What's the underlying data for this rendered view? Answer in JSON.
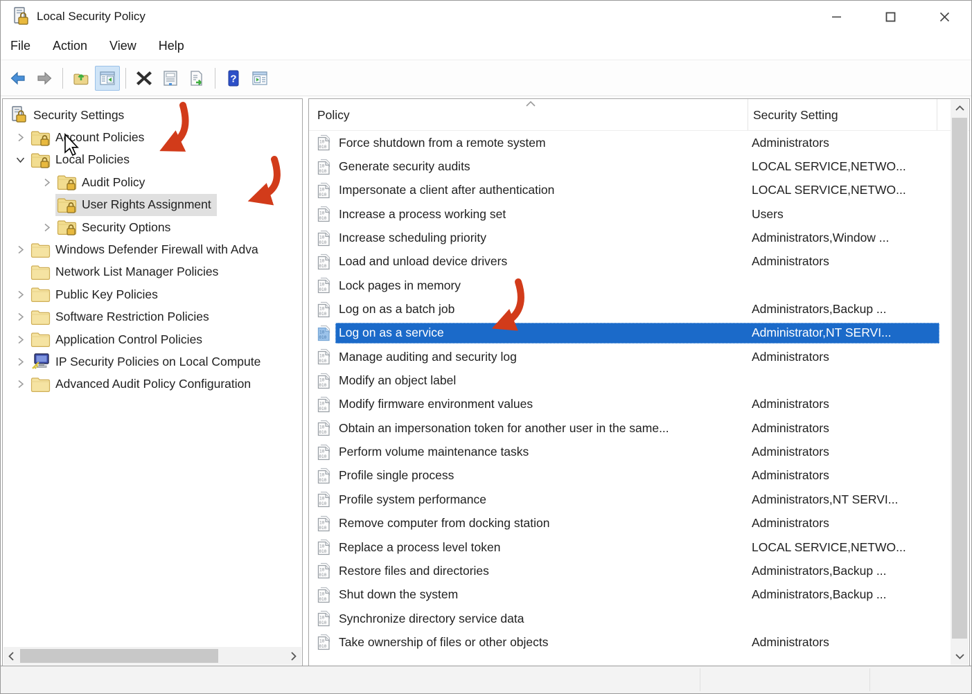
{
  "window": {
    "title": "Local Security Policy",
    "controls": {
      "minimize": "–",
      "maximize": "",
      "close": ""
    }
  },
  "menu": {
    "items": [
      {
        "label": "File"
      },
      {
        "label": "Action"
      },
      {
        "label": "View"
      },
      {
        "label": "Help"
      }
    ]
  },
  "toolbar": {
    "icons": [
      "back",
      "forward",
      "up-one-level",
      "show-hide-console-tree",
      "delete",
      "properties",
      "export-list",
      "help",
      "new-window"
    ],
    "active_icon": "show-hide-console-tree"
  },
  "tree": {
    "items": [
      {
        "label": "Security Settings",
        "level": 0,
        "expander": "none",
        "icon": "server-lock",
        "selected": false
      },
      {
        "label": "Account Policies",
        "level": 1,
        "expander": "collapsed",
        "icon": "folder-lock",
        "selected": false
      },
      {
        "label": "Local Policies",
        "level": 1,
        "expander": "expanded",
        "icon": "folder-lock",
        "selected": false
      },
      {
        "label": "Audit Policy",
        "level": 2,
        "expander": "collapsed",
        "icon": "folder-lock",
        "selected": false
      },
      {
        "label": "User Rights Assignment",
        "level": 2,
        "expander": "none",
        "icon": "folder-lock",
        "selected": true
      },
      {
        "label": "Security Options",
        "level": 2,
        "expander": "collapsed",
        "icon": "folder-lock",
        "selected": false
      },
      {
        "label": "Windows Defender Firewall with Adva",
        "level": 1,
        "expander": "collapsed",
        "icon": "folder",
        "selected": false
      },
      {
        "label": "Network List Manager Policies",
        "level": 1,
        "expander": "none",
        "icon": "folder",
        "selected": false
      },
      {
        "label": "Public Key Policies",
        "level": 1,
        "expander": "collapsed",
        "icon": "folder",
        "selected": false
      },
      {
        "label": "Software Restriction Policies",
        "level": 1,
        "expander": "collapsed",
        "icon": "folder",
        "selected": false
      },
      {
        "label": "Application Control Policies",
        "level": 1,
        "expander": "collapsed",
        "icon": "folder",
        "selected": false
      },
      {
        "label": "IP Security Policies on Local Compute",
        "level": 1,
        "expander": "collapsed",
        "icon": "ipsec",
        "selected": false
      },
      {
        "label": "Advanced Audit Policy Configuration",
        "level": 1,
        "expander": "collapsed",
        "icon": "folder",
        "selected": false
      }
    ]
  },
  "list": {
    "columns": [
      {
        "label": "Policy"
      },
      {
        "label": "Security Setting"
      }
    ],
    "sort": "ascending",
    "rows": [
      {
        "policy": "Force shutdown from a remote system",
        "setting": "Administrators",
        "selected": false
      },
      {
        "policy": "Generate security audits",
        "setting": "LOCAL SERVICE,NETWO...",
        "selected": false
      },
      {
        "policy": "Impersonate a client after authentication",
        "setting": "LOCAL SERVICE,NETWO...",
        "selected": false
      },
      {
        "policy": "Increase a process working set",
        "setting": "Users",
        "selected": false
      },
      {
        "policy": "Increase scheduling priority",
        "setting": "Administrators,Window ...",
        "selected": false
      },
      {
        "policy": "Load and unload device drivers",
        "setting": "Administrators",
        "selected": false
      },
      {
        "policy": "Lock pages in memory",
        "setting": "",
        "selected": false
      },
      {
        "policy": "Log on as a batch job",
        "setting": "Administrators,Backup ...",
        "selected": false
      },
      {
        "policy": "Log on as a service",
        "setting": "Administrator,NT SERVI...",
        "selected": true
      },
      {
        "policy": "Manage auditing and security log",
        "setting": "Administrators",
        "selected": false
      },
      {
        "policy": "Modify an object label",
        "setting": "",
        "selected": false
      },
      {
        "policy": "Modify firmware environment values",
        "setting": "Administrators",
        "selected": false
      },
      {
        "policy": "Obtain an impersonation token for another user in the same...",
        "setting": "Administrators",
        "selected": false
      },
      {
        "policy": "Perform volume maintenance tasks",
        "setting": "Administrators",
        "selected": false
      },
      {
        "policy": "Profile single process",
        "setting": "Administrators",
        "selected": false
      },
      {
        "policy": "Profile system performance",
        "setting": "Administrators,NT SERVI...",
        "selected": false
      },
      {
        "policy": "Remove computer from docking station",
        "setting": "Administrators",
        "selected": false
      },
      {
        "policy": "Replace a process level token",
        "setting": "LOCAL SERVICE,NETWO...",
        "selected": false
      },
      {
        "policy": "Restore files and directories",
        "setting": "Administrators,Backup ...",
        "selected": false
      },
      {
        "policy": "Shut down the system",
        "setting": "Administrators,Backup ...",
        "selected": false
      },
      {
        "policy": "Synchronize directory service data",
        "setting": "",
        "selected": false
      },
      {
        "policy": "Take ownership of files or other objects",
        "setting": "Administrators",
        "selected": false
      }
    ]
  },
  "annotations": {
    "arrow_color": "#d23b1a",
    "arrows": [
      "points-to-local-policies",
      "points-to-user-rights-assignment",
      "points-to-log-on-as-a-service"
    ]
  },
  "colors": {
    "list_selection": "#1b6ac9",
    "tree_selection": "#e0e0e0",
    "folder_yellow": "#f2dd90"
  }
}
